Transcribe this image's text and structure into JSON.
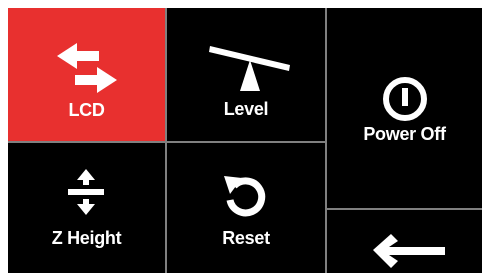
{
  "colors": {
    "active_tile": "#e8302f",
    "tile": "#000000",
    "grid_line": "#808080",
    "foreground": "#ffffff"
  },
  "menu": {
    "items": [
      {
        "id": "lcd",
        "label": "LCD",
        "icon": "swap-arrows-icon",
        "active": true
      },
      {
        "id": "level",
        "label": "Level",
        "icon": "level-icon",
        "active": false
      },
      {
        "id": "power",
        "label": "Power Off",
        "icon": "power-icon",
        "active": false
      },
      {
        "id": "z_height",
        "label": "Z Height",
        "icon": "z-height-icon",
        "active": false
      },
      {
        "id": "reset",
        "label": "Reset",
        "icon": "reset-icon",
        "active": false
      },
      {
        "id": "back",
        "label": "",
        "icon": "back-arrow-icon",
        "active": false
      }
    ]
  }
}
